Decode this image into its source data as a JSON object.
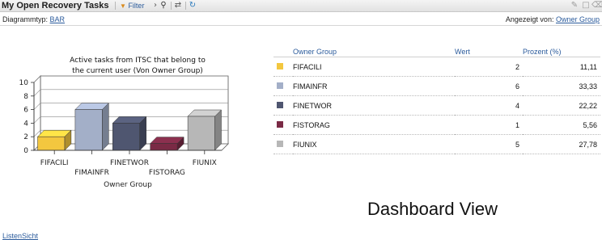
{
  "header": {
    "title": "My Open Recovery Tasks",
    "filter_label": "Filter",
    "icons": [
      "filter-icon",
      "binoculars-icon",
      "refresh-icon",
      "link-icon",
      "edit-icon",
      "maximize-icon",
      "delete-icon"
    ]
  },
  "sub": {
    "diagram_label": "Diagrammtyp:",
    "diagram_value": "BAR",
    "shown_by_label": "Angezeigt von:",
    "shown_by_value": "Owner Group"
  },
  "chart_data": {
    "type": "bar",
    "title_line1": "Active tasks from ITSC that belong to",
    "title_line2": "the current user (Von Owner Group)",
    "categories": [
      "FIFACILI",
      "FIMAINFR",
      "FINETWOR",
      "FISTORAG",
      "FIUNIX"
    ],
    "values": [
      2,
      6,
      4,
      1,
      5
    ],
    "colors": [
      "#f3c73f",
      "#a3afc8",
      "#4f5670",
      "#7a2a45",
      "#b7b7b7"
    ],
    "xlabel": "Owner Group",
    "ylabel": "",
    "ylim": [
      0,
      10
    ],
    "yticks": [
      0,
      2,
      4,
      6,
      8,
      10
    ],
    "grid": true
  },
  "table": {
    "headers": [
      "Owner Group",
      "Wert",
      "Prozent (%)"
    ],
    "rows": [
      {
        "label": "FIFACILI",
        "value": "2",
        "percent": "11,11",
        "color": "#f3c73f"
      },
      {
        "label": "FIMAINFR",
        "value": "6",
        "percent": "33,33",
        "color": "#a3afc8"
      },
      {
        "label": "FINETWOR",
        "value": "4",
        "percent": "22,22",
        "color": "#4f5670"
      },
      {
        "label": "FISTORAG",
        "value": "1",
        "percent": "5,56",
        "color": "#7a2a45"
      },
      {
        "label": "FIUNIX",
        "value": "5",
        "percent": "27,78",
        "color": "#b7b7b7"
      }
    ]
  },
  "overlay_text": "Dashboard View",
  "footer": {
    "list_view": "ListenSicht"
  }
}
